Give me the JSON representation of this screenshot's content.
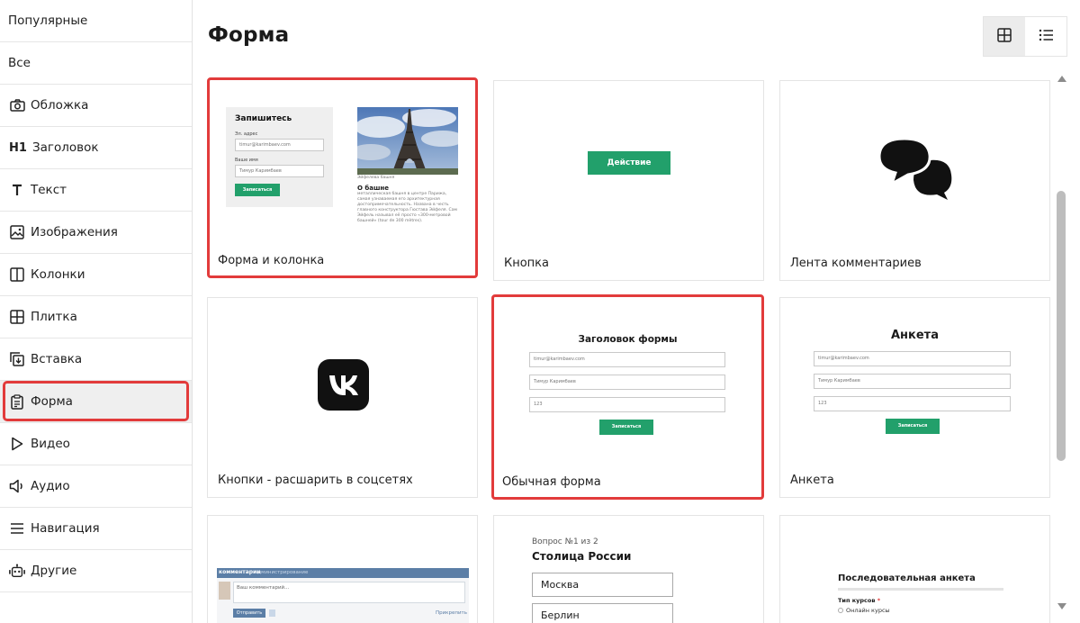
{
  "sidebar": {
    "items": [
      {
        "label": "Популярные",
        "icon": ""
      },
      {
        "label": "Все",
        "icon": ""
      },
      {
        "label": "Обложка",
        "icon": "camera-icon"
      },
      {
        "label": "Заголовок",
        "icon": "h1-icon"
      },
      {
        "label": "Текст",
        "icon": "text-icon"
      },
      {
        "label": "Изображения",
        "icon": "image-icon"
      },
      {
        "label": "Колонки",
        "icon": "columns-icon"
      },
      {
        "label": "Плитка",
        "icon": "grid-icon"
      },
      {
        "label": "Вставка",
        "icon": "insert-icon"
      },
      {
        "label": "Форма",
        "icon": "clipboard-icon"
      },
      {
        "label": "Видео",
        "icon": "play-icon"
      },
      {
        "label": "Аудио",
        "icon": "speaker-icon"
      },
      {
        "label": "Навигация",
        "icon": "menu-icon"
      },
      {
        "label": "Другие",
        "icon": "robot-icon"
      }
    ],
    "active": "Форма"
  },
  "header": {
    "title": "Форма",
    "view_modes": [
      "grid-view-icon",
      "list-view-icon"
    ]
  },
  "cards": {
    "form_column": {
      "caption": "Форма и колонка",
      "preview": {
        "form_title": "Запишитесь",
        "email_label": "Эл. адрес",
        "email_value": "timur@karimbaev.com",
        "name_label": "Ваше имя",
        "name_value": "Тимур Каримбаев",
        "button": "Записаться",
        "image_caption": "Эйфелева башня",
        "about_title": "О башне",
        "about_text": "металлическая башня в центре Парижа, самая узнаваемая его архитектурная достопримечательность. Названа в честь главного конструктора Гюстава Эйфеля. Сам Эйфель называл её просто «300-метровой башней» (tour de 300 mètres)."
      }
    },
    "button": {
      "caption": "Кнопка",
      "preview": {
        "button": "Действие"
      }
    },
    "comments_feed": {
      "caption": "Лента комментариев"
    },
    "share_buttons": {
      "caption": "Кнопки - расшарить в соцсетях"
    },
    "simple_form": {
      "caption": "Обычная форма",
      "preview": {
        "title": "Заголовок формы",
        "email": "timur@karimbaev.com",
        "name": "Тимур Каримбаев",
        "number": "123",
        "button": "Записаться"
      }
    },
    "survey": {
      "caption": "Анкета",
      "preview": {
        "title": "Анкета",
        "email": "timur@karimbaev.com",
        "name": "Тимур Каримбаев",
        "number": "123",
        "button": "Записаться"
      }
    },
    "vk_comments": {
      "preview": {
        "header_label": "комментарии",
        "header_extra": "администрирование",
        "placeholder": "Ваш комментарий...",
        "send": "Отправить",
        "attach": "Прикрепить"
      }
    },
    "quiz": {
      "preview": {
        "counter": "Вопрос №1 из 2",
        "question": "Столица России",
        "options": [
          "Москва",
          "Берлин"
        ]
      }
    },
    "sequential_survey": {
      "preview": {
        "title": "Последовательная анкета",
        "field_label": "Тип курсов",
        "required_mark": "*",
        "option": "Онлайн курсы"
      }
    }
  },
  "colors": {
    "accent_green": "#22a06b",
    "highlight_red": "#e23b3b",
    "vk_header": "#5b7ea6"
  }
}
